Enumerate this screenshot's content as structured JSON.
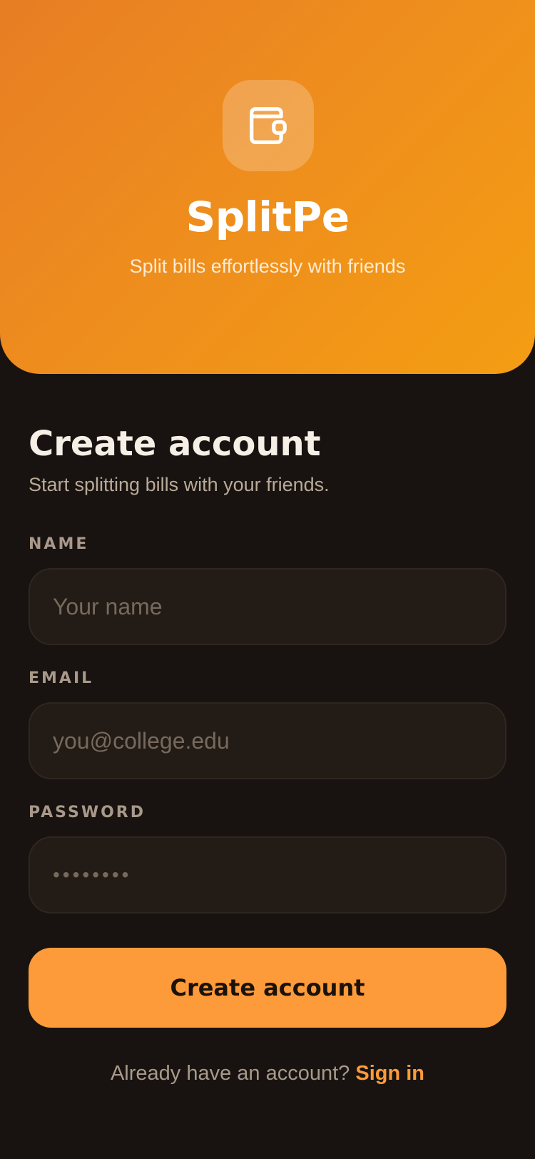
{
  "brand": {
    "logo_icon": "wallet-icon",
    "app_name": "SplitPe",
    "tagline": "Split bills effortlessly with friends"
  },
  "form": {
    "heading": "Create account",
    "subheading": "Start splitting bills with your friends.",
    "name": {
      "label": "NAME",
      "placeholder": "Your name",
      "value": ""
    },
    "email": {
      "label": "EMAIL",
      "placeholder": "you@college.edu",
      "value": ""
    },
    "password": {
      "label": "PASSWORD",
      "masked_value": "••••••••"
    },
    "submit_label": "Create account"
  },
  "footer": {
    "prompt": "Already have an account?",
    "signin_label": "Sign in"
  },
  "colors": {
    "hero_gradient_start": "#e87d24",
    "hero_gradient_end": "#f49d12",
    "accent": "#fd9a3a",
    "background": "#181310",
    "field_background": "#221b16"
  }
}
